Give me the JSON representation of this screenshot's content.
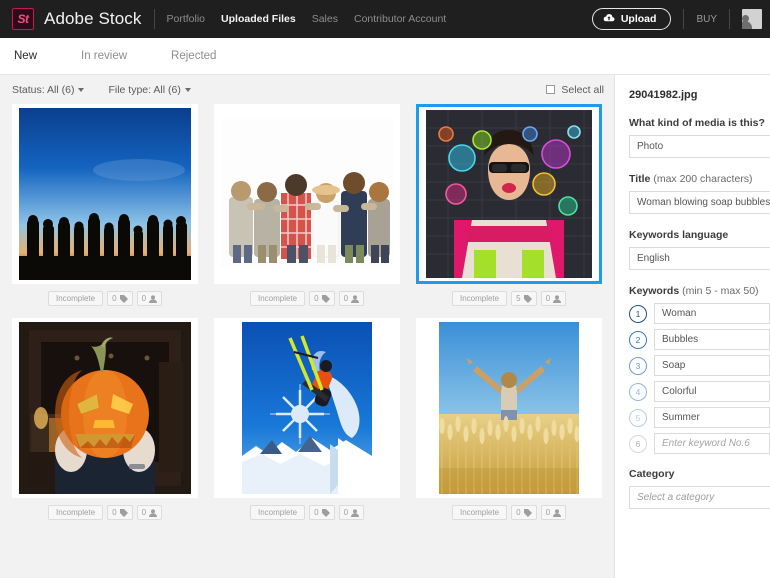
{
  "header": {
    "logo_text": "St",
    "brand": "Adobe Stock",
    "nav": [
      {
        "label": "Portfolio",
        "active": false
      },
      {
        "label": "Uploaded Files",
        "active": true
      },
      {
        "label": "Sales",
        "active": false
      },
      {
        "label": "Contributor Account",
        "active": false
      }
    ],
    "upload_label": "Upload",
    "buy_label": "BUY",
    "background": "#1f1f20",
    "accent": "#c2185b"
  },
  "tabs": [
    {
      "label": "New",
      "active": true
    },
    {
      "label": "In review",
      "active": false
    },
    {
      "label": "Rejected",
      "active": false
    }
  ],
  "filters": {
    "status": "Status: All (6)",
    "file_type": "File type: All (6)",
    "select_all": "Select all"
  },
  "grid": {
    "items": [
      {
        "name": "silhouettes-at-sunset",
        "selected": false,
        "status": "Incomplete",
        "keyword_count": "0",
        "category_count": "0"
      },
      {
        "name": "friends-arm-in-arm",
        "selected": false,
        "status": "Incomplete",
        "keyword_count": "0",
        "category_count": "0"
      },
      {
        "name": "woman-blowing-soap-bubbles",
        "selected": true,
        "status": "Incomplete",
        "keyword_count": "5",
        "category_count": "0"
      },
      {
        "name": "jack-o-lantern-pumpkin-head",
        "selected": false,
        "status": "Incomplete",
        "keyword_count": "0",
        "category_count": "0"
      },
      {
        "name": "skier-jumping",
        "selected": false,
        "status": "Incomplete",
        "keyword_count": "0",
        "category_count": "0"
      },
      {
        "name": "man-in-wheat-field",
        "selected": false,
        "status": "Incomplete",
        "keyword_count": "0",
        "category_count": "0"
      }
    ]
  },
  "sidebar": {
    "filename": "29041982.jpg",
    "media_type_label": "What kind of media is this?",
    "media_type_value": "Photo",
    "title_label": "Title",
    "title_hint": "(max 200 characters)",
    "title_value": "Woman blowing soap bubbles",
    "keywords_language_label": "Keywords language",
    "keywords_language_value": "English",
    "keywords_label": "Keywords",
    "keywords_hint": "(min 5 - max 50)",
    "keywords": [
      {
        "num": "1",
        "value": "Woman",
        "empty": false
      },
      {
        "num": "2",
        "value": "Bubbles",
        "empty": false
      },
      {
        "num": "3",
        "value": "Soap",
        "empty": false
      },
      {
        "num": "4",
        "value": "Colorful",
        "empty": false
      },
      {
        "num": "5",
        "value": "Summer",
        "empty": false
      },
      {
        "num": "6",
        "value": "Enter keyword No.6",
        "empty": true
      }
    ],
    "category_label": "Category",
    "category_placeholder": "Select a category"
  }
}
